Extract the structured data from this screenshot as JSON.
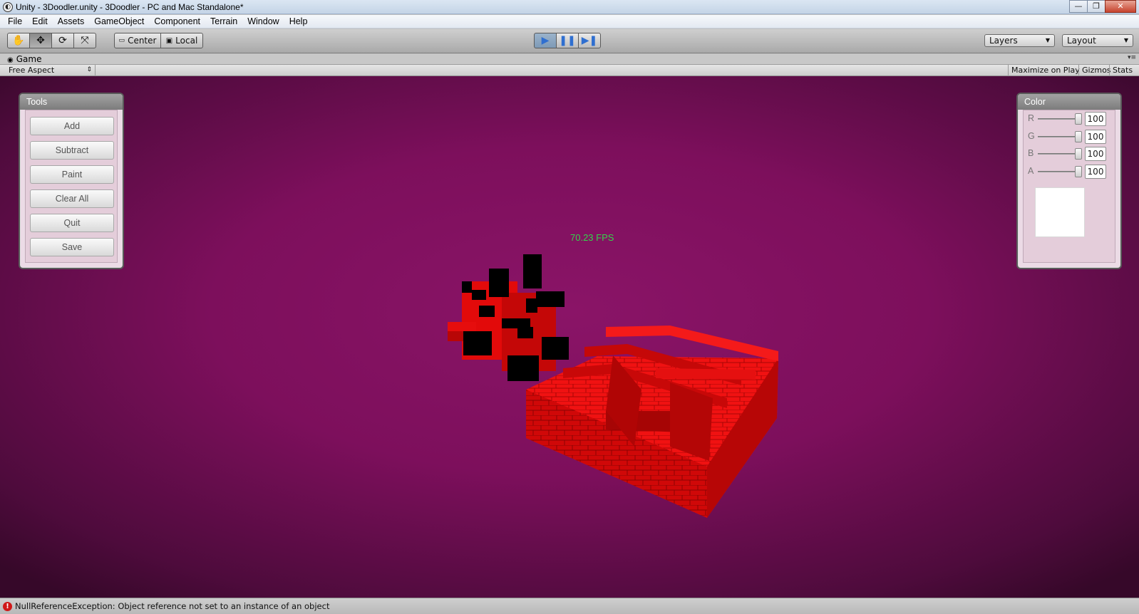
{
  "window": {
    "title": "Unity - 3Doodler.unity - 3Doodler - PC and Mac Standalone*",
    "minimize": "—",
    "restore": "❐",
    "close": "✕"
  },
  "menu": [
    "File",
    "Edit",
    "Assets",
    "GameObject",
    "Component",
    "Terrain",
    "Window",
    "Help"
  ],
  "toolbar": {
    "pivot_center": "Center",
    "pivot_local": "Local",
    "layers": "Layers",
    "layout": "Layout"
  },
  "game": {
    "tab_label": "Game",
    "aspect": "Free Aspect",
    "maximize_on_play": "Maximize on Play",
    "gizmos": "Gizmos",
    "stats": "Stats",
    "fps": "70.23 FPS"
  },
  "tools_panel": {
    "title": "Tools",
    "buttons": [
      "Add",
      "Subtract",
      "Paint",
      "Clear All",
      "Quit",
      "Save"
    ]
  },
  "color_panel": {
    "title": "Color",
    "channels": [
      {
        "label": "R",
        "value": "100"
      },
      {
        "label": "G",
        "value": "100"
      },
      {
        "label": "B",
        "value": "100"
      },
      {
        "label": "A",
        "value": "100"
      }
    ],
    "swatch_color": "#ffffff"
  },
  "status": {
    "message": "NullReferenceException: Object reference not set to an instance of an object"
  },
  "colors": {
    "background": "#7d0f5c",
    "voxel_red": "#e10a0a",
    "voxel_black": "#000000",
    "fps_text": "#34d44a"
  }
}
